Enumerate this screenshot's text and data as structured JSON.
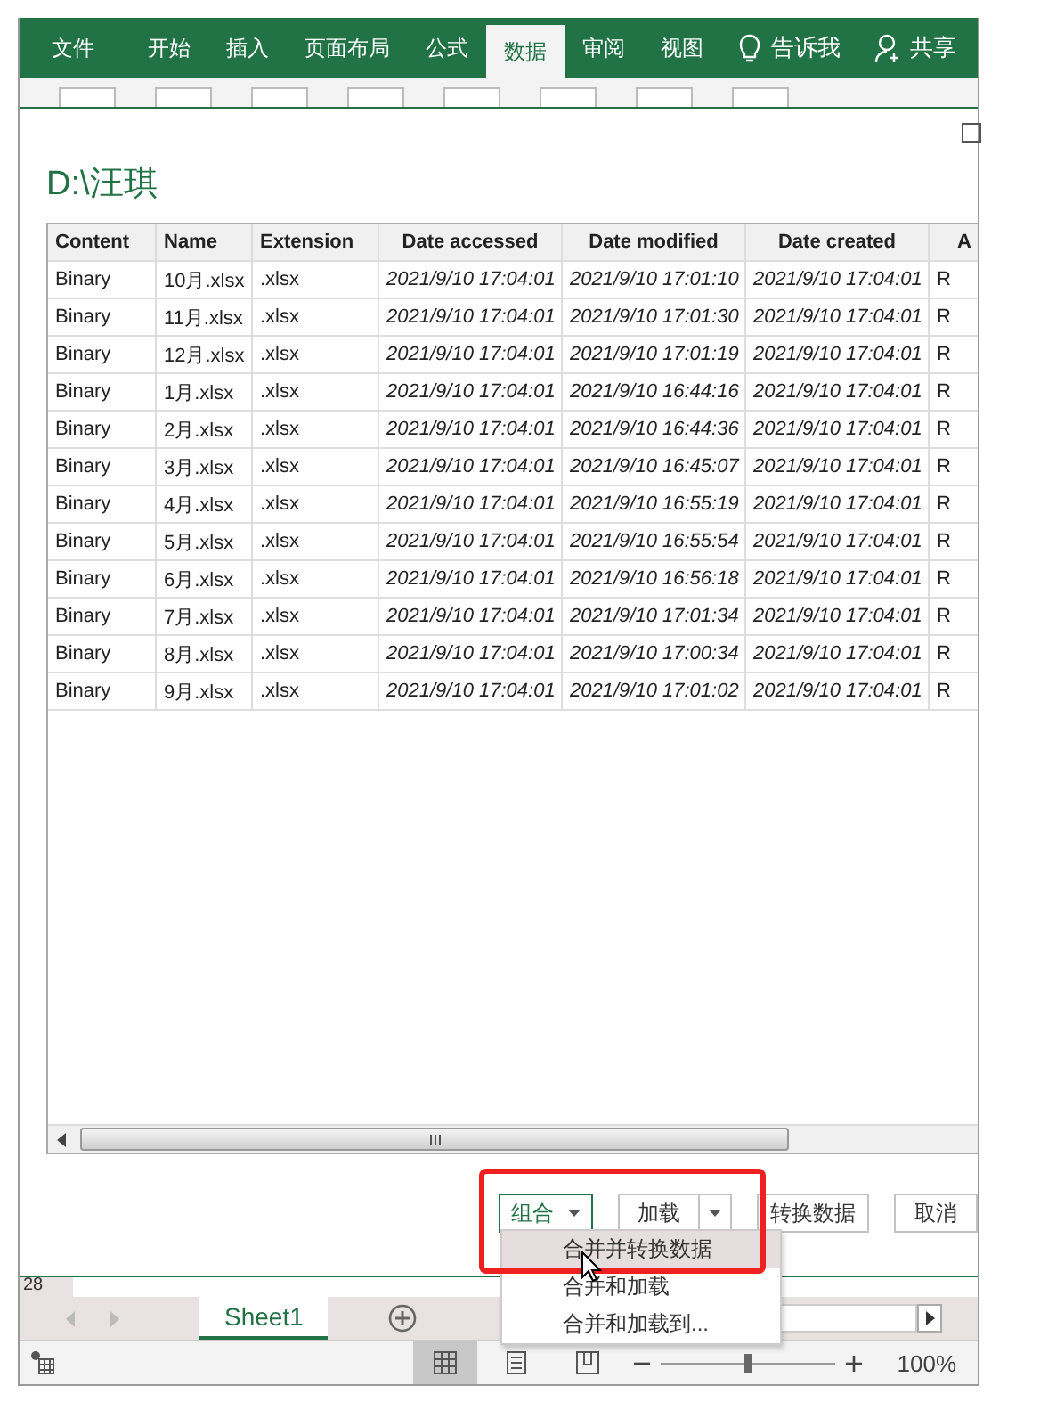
{
  "ribbon": {
    "tabs": [
      {
        "label": "文件",
        "selected": false
      },
      {
        "label": "开始",
        "selected": false
      },
      {
        "label": "插入",
        "selected": false
      },
      {
        "label": "页面布局",
        "selected": false
      },
      {
        "label": "公式",
        "selected": false
      },
      {
        "label": "数据",
        "selected": true
      },
      {
        "label": "审阅",
        "selected": false
      },
      {
        "label": "视图",
        "selected": false
      }
    ],
    "tell_me": "告诉我",
    "share": "共享"
  },
  "dialog": {
    "title": "D:\\汪琪",
    "table": {
      "columns": [
        "Content",
        "Name",
        "Extension",
        "Date accessed",
        "Date modified",
        "Date created",
        "A"
      ],
      "rows": [
        [
          "Binary",
          "10月.xlsx",
          ".xlsx",
          "2021/9/10 17:04:01",
          "2021/9/10 17:01:10",
          "2021/9/10 17:04:01",
          "R"
        ],
        [
          "Binary",
          "11月.xlsx",
          ".xlsx",
          "2021/9/10 17:04:01",
          "2021/9/10 17:01:30",
          "2021/9/10 17:04:01",
          "R"
        ],
        [
          "Binary",
          "12月.xlsx",
          ".xlsx",
          "2021/9/10 17:04:01",
          "2021/9/10 17:01:19",
          "2021/9/10 17:04:01",
          "R"
        ],
        [
          "Binary",
          "1月.xlsx",
          ".xlsx",
          "2021/9/10 17:04:01",
          "2021/9/10 16:44:16",
          "2021/9/10 17:04:01",
          "R"
        ],
        [
          "Binary",
          "2月.xlsx",
          ".xlsx",
          "2021/9/10 17:04:01",
          "2021/9/10 16:44:36",
          "2021/9/10 17:04:01",
          "R"
        ],
        [
          "Binary",
          "3月.xlsx",
          ".xlsx",
          "2021/9/10 17:04:01",
          "2021/9/10 16:45:07",
          "2021/9/10 17:04:01",
          "R"
        ],
        [
          "Binary",
          "4月.xlsx",
          ".xlsx",
          "2021/9/10 17:04:01",
          "2021/9/10 16:55:19",
          "2021/9/10 17:04:01",
          "R"
        ],
        [
          "Binary",
          "5月.xlsx",
          ".xlsx",
          "2021/9/10 17:04:01",
          "2021/9/10 16:55:54",
          "2021/9/10 17:04:01",
          "R"
        ],
        [
          "Binary",
          "6月.xlsx",
          ".xlsx",
          "2021/9/10 17:04:01",
          "2021/9/10 16:56:18",
          "2021/9/10 17:04:01",
          "R"
        ],
        [
          "Binary",
          "7月.xlsx",
          ".xlsx",
          "2021/9/10 17:04:01",
          "2021/9/10 17:01:34",
          "2021/9/10 17:04:01",
          "R"
        ],
        [
          "Binary",
          "8月.xlsx",
          ".xlsx",
          "2021/9/10 17:04:01",
          "2021/9/10 17:00:34",
          "2021/9/10 17:04:01",
          "R"
        ],
        [
          "Binary",
          "9月.xlsx",
          ".xlsx",
          "2021/9/10 17:04:01",
          "2021/9/10 17:01:02",
          "2021/9/10 17:04:01",
          "R"
        ]
      ]
    },
    "buttons": [
      {
        "label": "组合",
        "kind": "split-primary"
      },
      {
        "label": "加载",
        "kind": "split"
      },
      {
        "label": "转换数据",
        "kind": "plain"
      },
      {
        "label": "取消",
        "kind": "plain"
      }
    ],
    "menu": [
      {
        "label": "合并并转换数据",
        "selected": true
      },
      {
        "label": "合并和加载",
        "selected": false
      },
      {
        "label": "合并和加载到...",
        "selected": false
      }
    ]
  },
  "sheet": {
    "row_number": "28",
    "tabs": [
      {
        "label": "Sheet1",
        "selected": true
      }
    ]
  },
  "status_bar": {
    "views": [
      {
        "kind": "normal",
        "selected": true
      },
      {
        "kind": "page-layout",
        "selected": false
      },
      {
        "kind": "page-break",
        "selected": false
      }
    ],
    "zoom_slider": {
      "level": 0.5
    },
    "zoom": "100%"
  }
}
